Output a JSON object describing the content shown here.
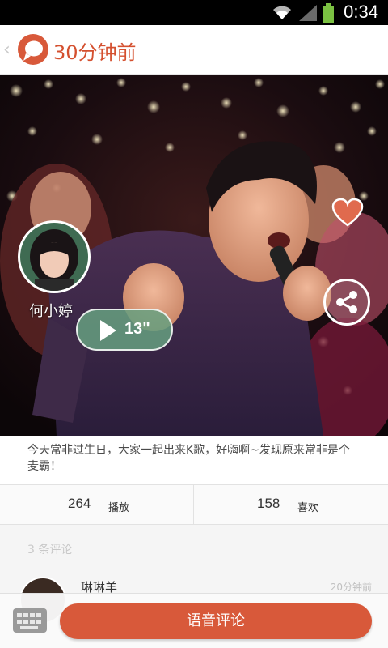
{
  "status_bar": {
    "time": "0:34",
    "wifi_icon": "wifi-icon",
    "signal_icon": "signal-icon",
    "battery_icon": "battery-icon"
  },
  "header": {
    "title": "30分钟前",
    "back_icon": "back-chevron-icon",
    "logo_icon": "speech-bubble-logo-icon"
  },
  "post": {
    "author": "何小婷",
    "voice_duration": "13\"",
    "caption": "今天常非过生日，大家一起出来K歌，好嗨啊~发现原来常非是个麦霸！",
    "plays": "264",
    "plays_label": "播放",
    "likes": "158",
    "likes_label": "喜欢"
  },
  "comments": {
    "header_count": "3",
    "header_label": "条评论",
    "items": [
      {
        "name": "琳琳羊",
        "time": "20分钟前"
      }
    ]
  },
  "bottom_bar": {
    "voice_comment_label": "语音评论",
    "keyboard_icon": "keyboard-icon"
  },
  "colors": {
    "accent": "#d8593a",
    "title_orange": "#d4502f",
    "voice_green": "#66a080"
  }
}
